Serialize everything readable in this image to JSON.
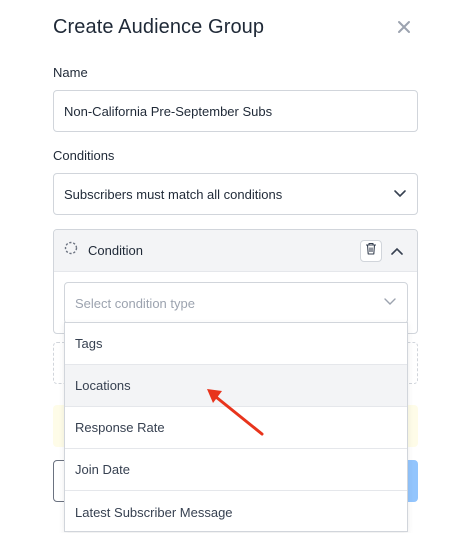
{
  "dialog": {
    "title": "Create Audience Group",
    "name_label": "Name",
    "name_value": "Non-California Pre-September Subs",
    "conditions_label": "Conditions",
    "match_mode": "Subscribers must match all conditions"
  },
  "condition": {
    "title": "Condition",
    "type_placeholder": "Select condition type",
    "options": [
      "Tags",
      "Locations",
      "Response Rate",
      "Join Date",
      "Latest Subscriber Message"
    ],
    "hovered_option": "Locations"
  },
  "colors": {
    "annotation_arrow": "#e8341c",
    "hover_bg": "#f3f4f6",
    "primary_button": "#93c5fd"
  },
  "icons": {
    "close": "close-icon",
    "match_mode_chevron": "chevron-down-icon",
    "condition_status": "dashed-circle-icon",
    "delete": "trash-icon",
    "collapse": "chevron-up-icon",
    "type_chevron": "chevron-down-icon"
  }
}
